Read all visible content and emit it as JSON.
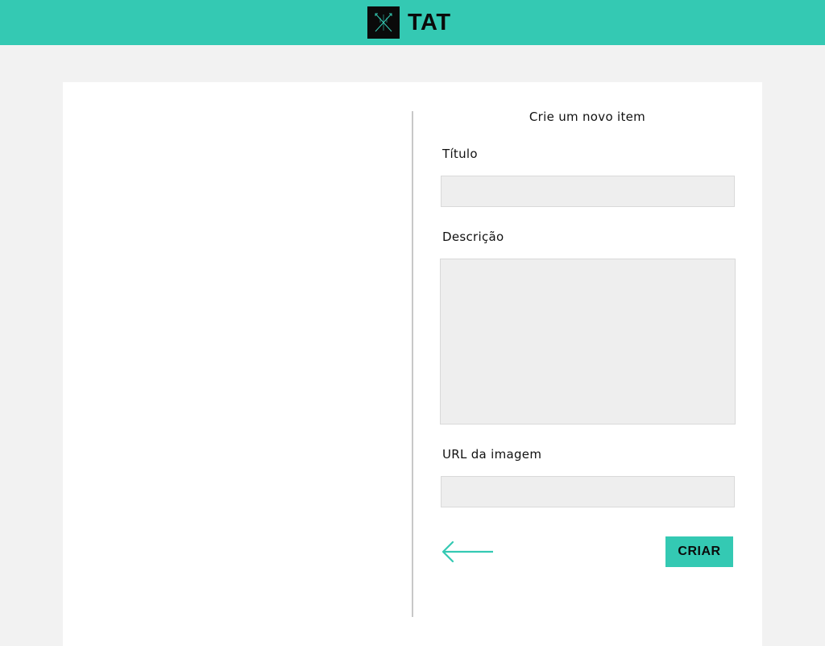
{
  "header": {
    "brand": "TAT",
    "accent_color": "#34c9b3",
    "logo_icon": "crossed-arrows-logo-icon"
  },
  "form": {
    "title": "Crie um novo item",
    "fields": {
      "title_label": "Título",
      "title_value": "",
      "description_label": "Descrição",
      "description_value": "",
      "image_url_label": "URL da imagem",
      "image_url_value": ""
    },
    "back_icon": "arrow-left-icon",
    "submit_label": "CRIAR"
  }
}
